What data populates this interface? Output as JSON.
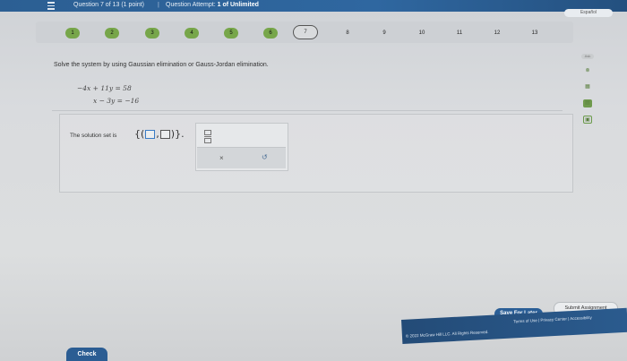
{
  "header": {
    "question_info": "Question 7 of 13 (1 point)",
    "separator": "|",
    "attempt_label": "Question Attempt:",
    "attempt_value": "1 of Unlimited",
    "corner_button": "Español"
  },
  "question_nav": [
    "1",
    "2",
    "3",
    "4",
    "5",
    "6",
    "7",
    "8",
    "9",
    "10",
    "11",
    "12",
    "13"
  ],
  "question": {
    "instructions": "Solve the system by using Gaussian elimination or Gauss-Jordan elimination.",
    "equations": [
      "−4x + 11y = 58",
      "x − 3y = −16"
    ]
  },
  "answer": {
    "label": "The solution set is",
    "set_open": "{(",
    "comma": ",",
    "set_close": ")}."
  },
  "palette": {
    "fraction_icon": "fraction-icon",
    "clear_symbol": "×",
    "undo_symbol": "↺"
  },
  "side_tools": [
    "Ask",
    "⊗",
    "▦",
    "▤",
    "▣"
  ],
  "buttons": {
    "save_later": "Save For Later",
    "submit": "Submit Assignment",
    "check": "Check"
  },
  "footer": {
    "copyright": "© 2022 McGraw Hill LLC. All Rights Reserved.",
    "links": "Terms of Use | Privacy Center | Accessibility"
  },
  "colors": {
    "top_bar": "#2f67a0",
    "completed_question": "#77a64a",
    "primary_button": "#2a5e96"
  }
}
